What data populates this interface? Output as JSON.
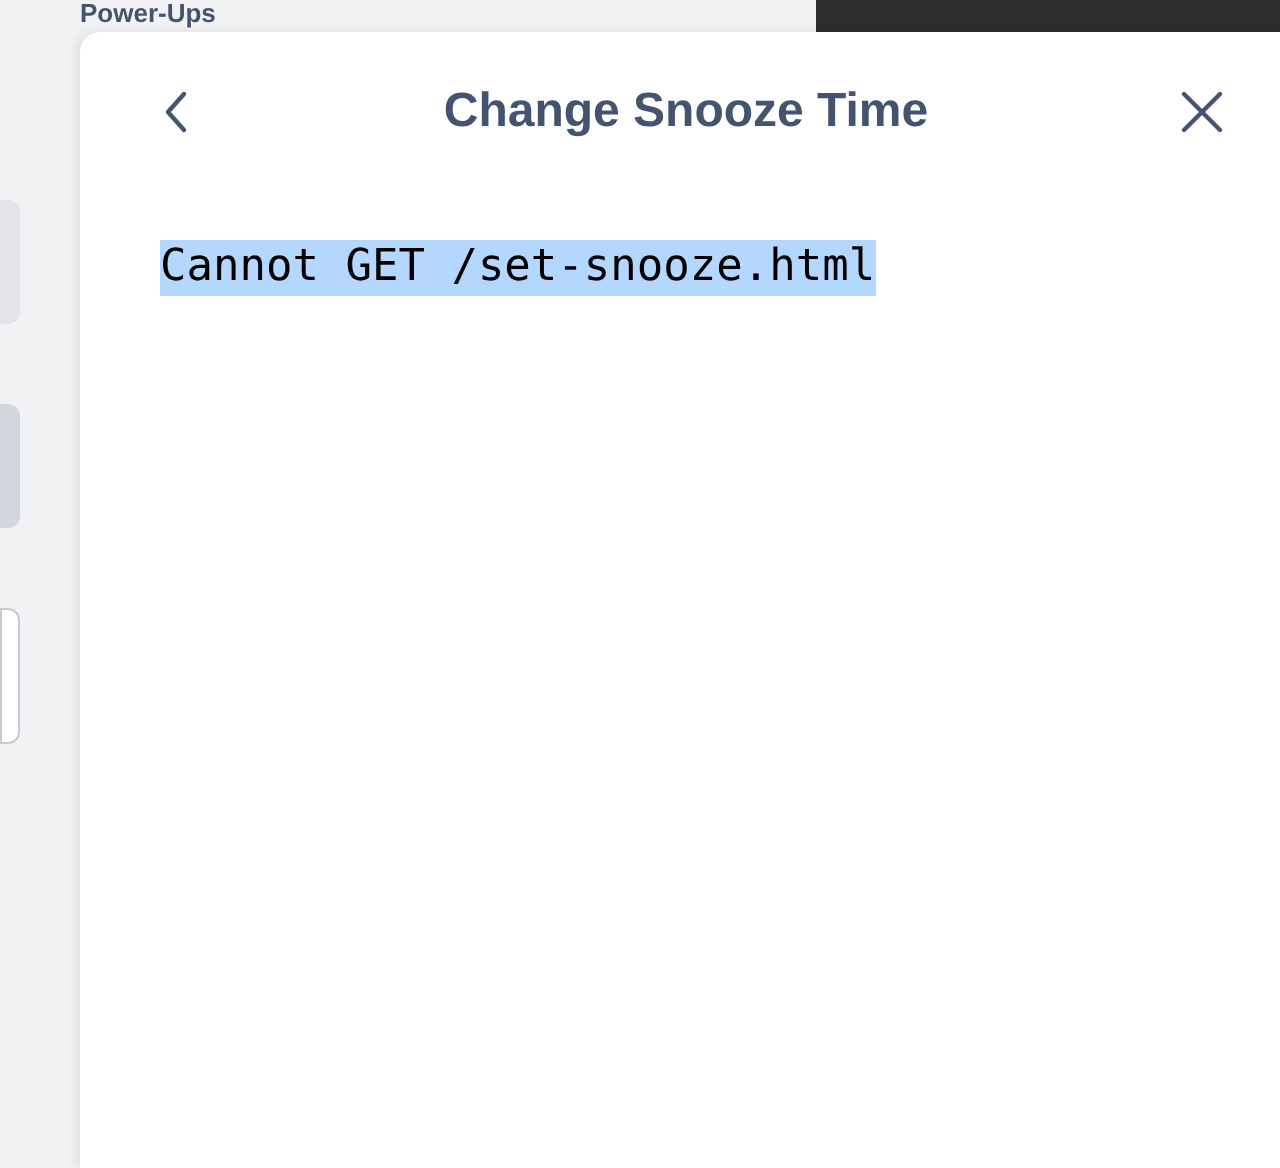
{
  "background": {
    "section_title": "Power-Ups"
  },
  "modal": {
    "title": "Change Snooze Time",
    "message": "Cannot GET /set-snooze.html",
    "message_selected": true
  }
}
